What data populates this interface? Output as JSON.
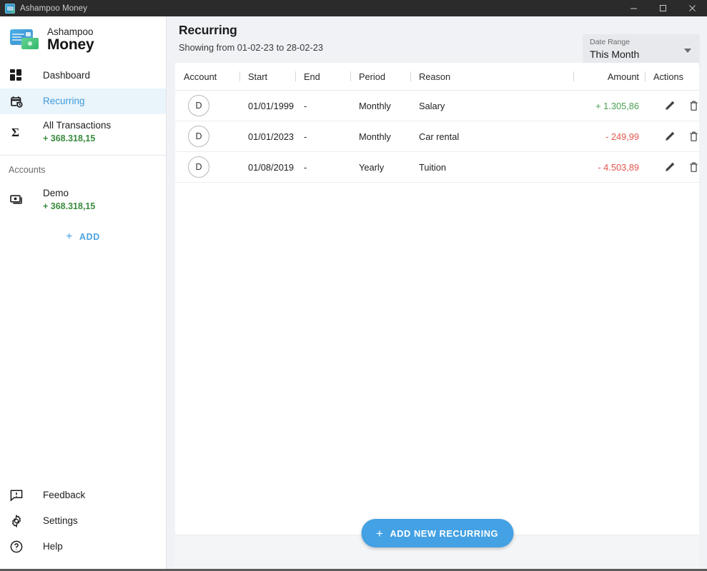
{
  "window": {
    "title": "Ashampoo Money",
    "app_icon": "app-icon",
    "minimize_label": "Minimize",
    "maximize_label": "Maximize",
    "close_label": "Close"
  },
  "sidebar": {
    "brand": {
      "line1": "Ashampoo",
      "line2": "Money",
      "logo_icon": "credit-card-and-cash-icon"
    },
    "nav": [
      {
        "id": "dashboard",
        "label": "Dashboard",
        "icon": "dashboard-grid-icon",
        "sub": "",
        "active": false
      },
      {
        "id": "recurring",
        "label": "Recurring",
        "icon": "calendar-repeat-icon",
        "sub": "",
        "active": true
      },
      {
        "id": "all-transactions",
        "label": "All Transactions",
        "icon": "sigma-icon",
        "sub": "+ 368.318,15",
        "active": false
      }
    ],
    "accounts_label": "Accounts",
    "accounts": [
      {
        "id": "demo",
        "label": "Demo",
        "icon": "banknotes-icon",
        "sub": "+ 368.318,15"
      }
    ],
    "add_label": "ADD",
    "add_icon": "plus-icon",
    "bottom_nav": [
      {
        "id": "feedback",
        "label": "Feedback",
        "icon": "feedback-message-icon"
      },
      {
        "id": "settings",
        "label": "Settings",
        "icon": "gear-icon"
      },
      {
        "id": "help",
        "label": "Help",
        "icon": "question-circle-icon"
      }
    ]
  },
  "header": {
    "title": "Recurring",
    "subtitle": "Showing from 01-02-23 to 28-02-23",
    "date_range": {
      "label": "Date Range",
      "value": "This Month",
      "caret_icon": "chevron-down-icon"
    }
  },
  "table": {
    "columns": [
      {
        "key": "account",
        "label": "Account"
      },
      {
        "key": "start",
        "label": "Start"
      },
      {
        "key": "end",
        "label": "End"
      },
      {
        "key": "period",
        "label": "Period"
      },
      {
        "key": "reason",
        "label": "Reason"
      },
      {
        "key": "amount",
        "label": "Amount"
      },
      {
        "key": "actions",
        "label": "Actions"
      }
    ],
    "rows": [
      {
        "avatar": "D",
        "start": "01/01/1999",
        "end": "-",
        "period": "Monthly",
        "reason": "Salary",
        "amount": "+ 1.305,86",
        "amount_sign": "pos",
        "edit_icon": "pencil-icon",
        "delete_icon": "trash-icon"
      },
      {
        "avatar": "D",
        "start": "01/01/2023",
        "end": "-",
        "period": "Monthly",
        "reason": "Car rental",
        "amount": "- 249,99",
        "amount_sign": "neg",
        "edit_icon": "pencil-icon",
        "delete_icon": "trash-icon"
      },
      {
        "avatar": "D",
        "start": "01/08/2019",
        "end": "-",
        "period": "Yearly",
        "reason": "Tuition",
        "amount": "- 4.503,89",
        "amount_sign": "neg",
        "edit_icon": "pencil-icon",
        "delete_icon": "trash-icon"
      }
    ]
  },
  "footer": {
    "add_recurring_label": "ADD NEW RECURRING",
    "add_recurring_icon": "plus-icon"
  },
  "colors": {
    "accent": "#43a1e4",
    "accent_light": "#eaf4fb",
    "positive": "#4a9e4f",
    "negative": "#e2564c",
    "titlebar": "#2b2b2b",
    "page_bg": "#f1f2f5"
  }
}
